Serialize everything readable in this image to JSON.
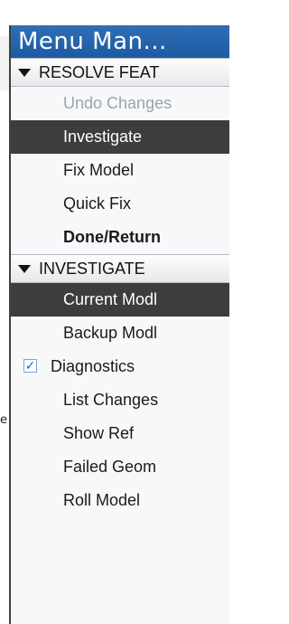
{
  "panel": {
    "title": "Menu Man..."
  },
  "background_text": "e",
  "sections": [
    {
      "header": "RESOLVE FEAT",
      "items": [
        {
          "label": "Undo Changes",
          "state": "disabled"
        },
        {
          "label": "Investigate",
          "state": "selected"
        },
        {
          "label": "Fix Model",
          "state": "normal"
        },
        {
          "label": "Quick Fix",
          "state": "normal"
        },
        {
          "label": "Done/Return",
          "state": "bold"
        }
      ]
    },
    {
      "header": "INVESTIGATE",
      "items": [
        {
          "label": "Current Modl",
          "state": "selected"
        },
        {
          "label": "Backup Modl",
          "state": "normal"
        },
        {
          "label": "Diagnostics",
          "state": "checked",
          "check": "✓"
        },
        {
          "label": "List Changes",
          "state": "normal"
        },
        {
          "label": "Show Ref",
          "state": "normal"
        },
        {
          "label": "Failed Geom",
          "state": "normal"
        },
        {
          "label": "Roll Model",
          "state": "normal"
        }
      ]
    }
  ],
  "colors": {
    "title_bar": "#1d5aa3",
    "selected_row": "#3d3d3d",
    "disabled_text": "#9ea3a8",
    "checkbox_border": "#7ea6d6",
    "checkmark": "#1e63b8"
  }
}
